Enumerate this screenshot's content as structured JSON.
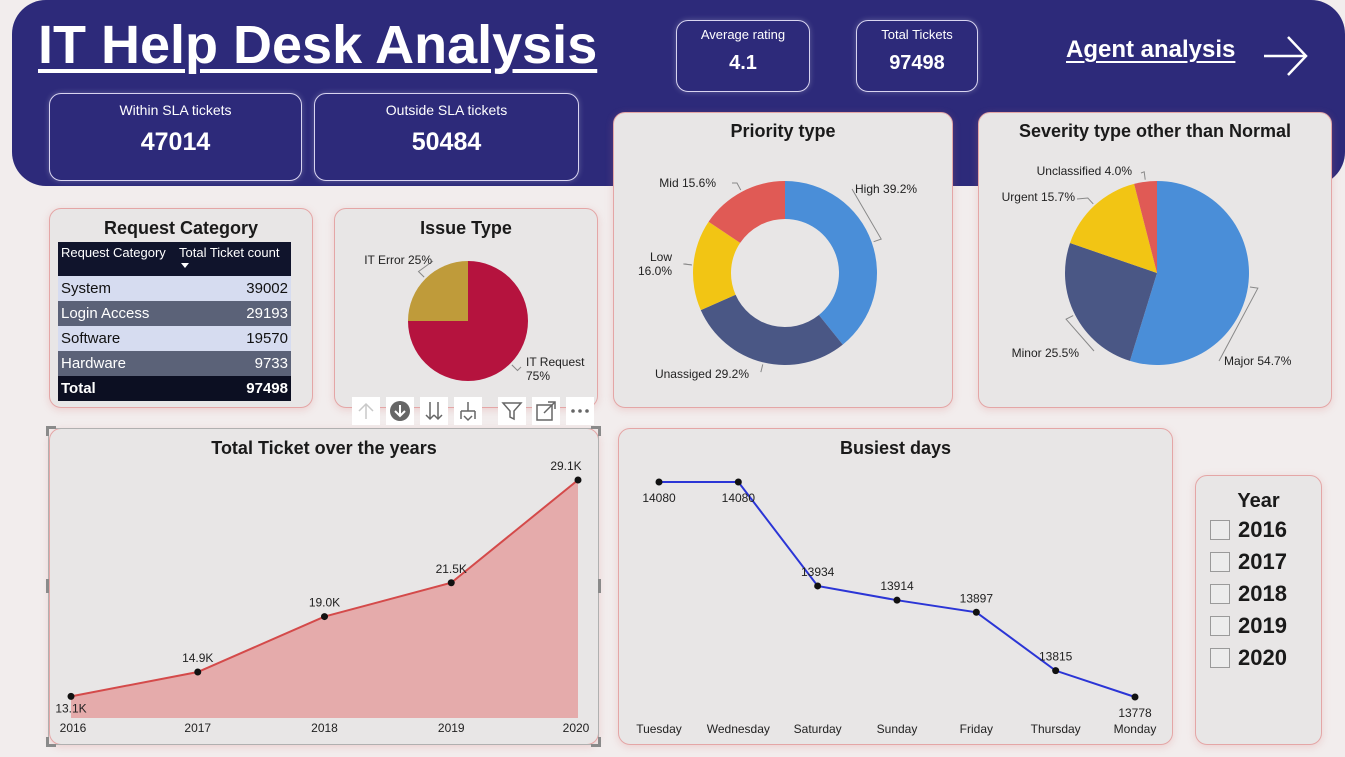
{
  "header": {
    "title": "IT Help Desk Analysis",
    "agent_link": "Agent analysis"
  },
  "kpis": {
    "average_rating": {
      "label": "Average rating",
      "value": "4.1"
    },
    "total_tickets": {
      "label": "Total Tickets",
      "value": "97498"
    },
    "within_sla": {
      "label": "Within SLA tickets",
      "value": "47014"
    },
    "outside_sla": {
      "label": "Outside SLA tickets",
      "value": "50484"
    }
  },
  "request_category": {
    "title": "Request Category",
    "columns": [
      "Request Category",
      "Total Ticket count"
    ],
    "rows": [
      {
        "category": "System",
        "count": "39002"
      },
      {
        "category": "Login Access",
        "count": "29193"
      },
      {
        "category": "Software",
        "count": "19570"
      },
      {
        "category": "Hardware",
        "count": "9733"
      }
    ],
    "total": {
      "label": "Total",
      "count": "97498"
    }
  },
  "toolbar": {
    "icons": [
      "arrow-up-icon",
      "drill-down-icon",
      "expand-all-icon",
      "expand-hierarchy-icon",
      "filter-icon",
      "focus-mode-icon",
      "more-options-icon"
    ]
  },
  "year_slicer": {
    "title": "Year",
    "options": [
      "2016",
      "2017",
      "2018",
      "2019",
      "2020"
    ]
  },
  "colors": {
    "header_bg": "#2d2a7a",
    "card_bg": "#e8e6e6",
    "page_bg": "#f2eded",
    "card_border": "#e4a6a6"
  },
  "chart_data": [
    {
      "type": "pie",
      "title": "Issue Type",
      "labels": [
        "IT Request",
        "IT Error"
      ],
      "values": [
        75,
        25
      ],
      "display_labels": [
        "IT Request 75%",
        "IT Error 25%"
      ],
      "colors": [
        "#b5133e",
        "#bf9b3a"
      ]
    },
    {
      "type": "pie",
      "variant": "donut",
      "title": "Priority type",
      "labels": [
        "High",
        "Unassiged",
        "Low",
        "Mid"
      ],
      "values": [
        39.2,
        29.2,
        16.0,
        15.6
      ],
      "display_labels": [
        "High 39.2%",
        "Unassiged 29.2%",
        "Low 16.0%",
        "Mid 15.6%"
      ],
      "colors": [
        "#4a8ed8",
        "#4a5785",
        "#f2c514",
        "#e05a55"
      ]
    },
    {
      "type": "pie",
      "title": "Severity type other than Normal",
      "labels": [
        "Major",
        "Minor",
        "Urgent",
        "Unclassified"
      ],
      "values": [
        54.7,
        25.5,
        15.7,
        4.0
      ],
      "display_labels": [
        "Major 54.7%",
        "Minor 25.5%",
        "Urgent 15.7%",
        "Unclassified 4.0%"
      ],
      "colors": [
        "#4a8ed8",
        "#4a5785",
        "#f2c514",
        "#e05a55"
      ]
    },
    {
      "type": "area",
      "title": "Total Ticket over the years",
      "x": [
        "2016",
        "2017",
        "2018",
        "2019",
        "2020"
      ],
      "values": [
        13.1,
        14.9,
        19.0,
        21.5,
        29.1
      ],
      "data_labels": [
        "13.1K",
        "14.9K",
        "19.0K",
        "21.5K",
        "29.1K"
      ],
      "ylim": [
        11.5,
        29.1
      ],
      "color": "#d44a4a",
      "fill": "#e4a4a4"
    },
    {
      "type": "line",
      "title": "Busiest days",
      "x": [
        "Tuesday",
        "Wednesday",
        "Saturday",
        "Sunday",
        "Friday",
        "Thursday",
        "Monday"
      ],
      "values": [
        14080,
        14080,
        13934,
        13914,
        13897,
        13815,
        13778
      ],
      "data_labels": [
        "14080",
        "14080",
        "13934",
        "13914",
        "13897",
        "13815",
        "13778"
      ],
      "ylim": [
        13778,
        14080
      ],
      "color": "#2b35d6"
    }
  ]
}
